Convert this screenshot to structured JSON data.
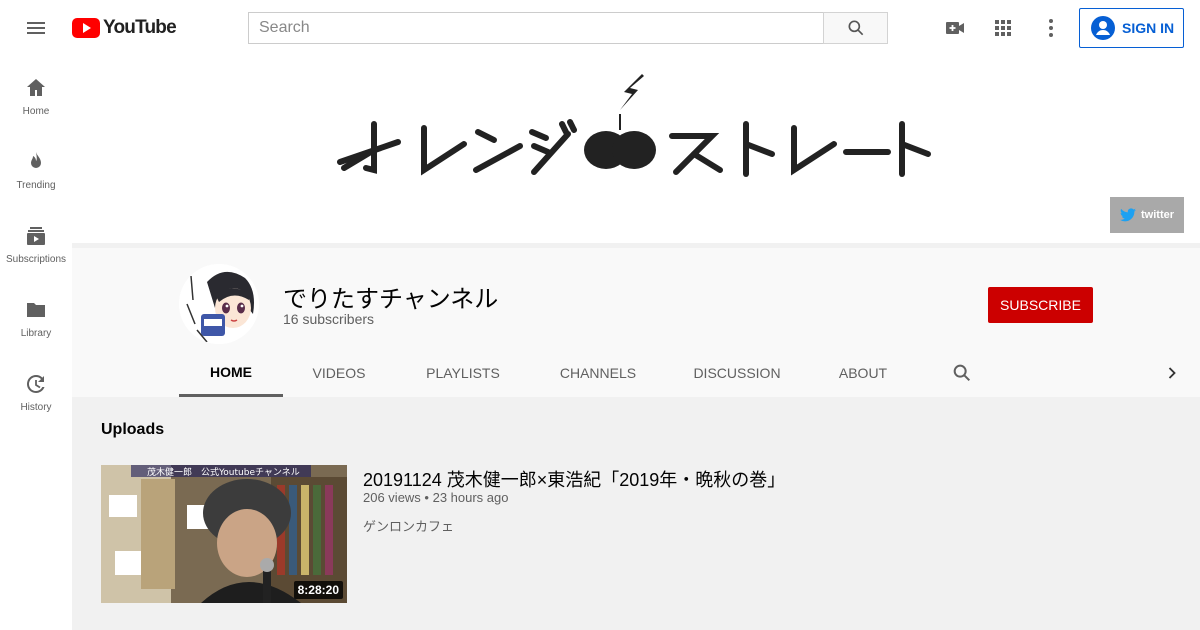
{
  "topbar": {
    "logo_text": "YouTube",
    "search_placeholder": "Search",
    "signin_label": "SIGN IN"
  },
  "sidebar": {
    "items": [
      {
        "label": "Home",
        "icon": "home-icon"
      },
      {
        "label": "Trending",
        "icon": "trending-icon"
      },
      {
        "label": "Subscriptions",
        "icon": "subscriptions-icon"
      },
      {
        "label": "Library",
        "icon": "library-icon"
      },
      {
        "label": "History",
        "icon": "history-icon"
      }
    ]
  },
  "banner": {
    "twitter_label": "twitter"
  },
  "channel": {
    "name": "でりたすチャンネル",
    "subscribers": "16 subscribers",
    "subscribe_label": "SUBSCRIBE"
  },
  "tabs": [
    "HOME",
    "VIDEOS",
    "PLAYLISTS",
    "CHANNELS",
    "DISCUSSION",
    "ABOUT"
  ],
  "uploads": {
    "title": "Uploads",
    "video": {
      "title": "20191124 茂木健一郎×東浩紀「2019年・晩秋の巻」",
      "meta": "206 views • 23 hours ago",
      "channel": "ゲンロンカフェ",
      "duration": "8:28:20",
      "thumb_caption": "茂木健一郎　公式Youtubeチャンネル"
    }
  },
  "colors": {
    "brand_red": "#ff0000",
    "subscribe_red": "#cc0000",
    "link_blue": "#065fd4",
    "twitter_blue": "#1da1f2"
  }
}
